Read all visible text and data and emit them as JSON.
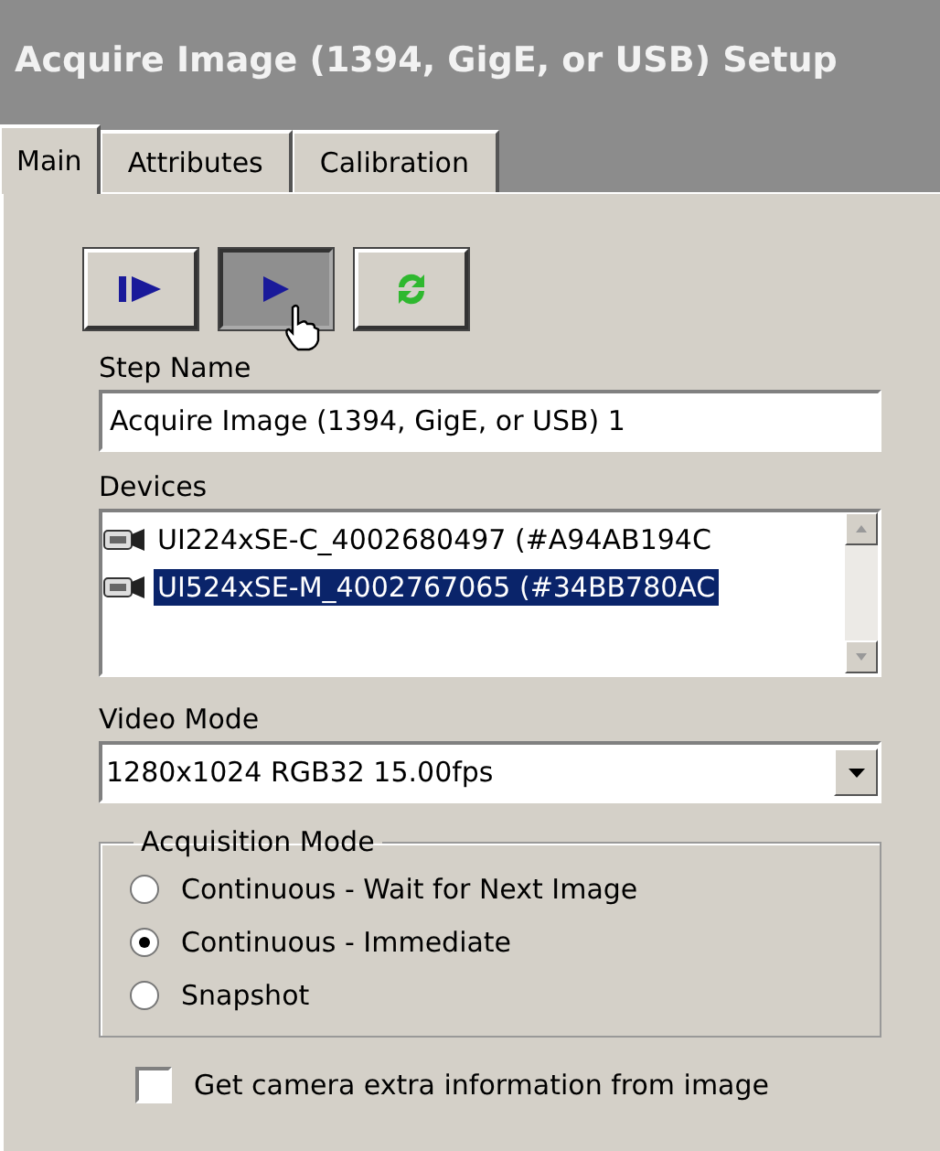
{
  "window": {
    "title": "Acquire Image (1394, GigE, or USB) Setup"
  },
  "tabs": [
    {
      "label": "Main",
      "selected": true
    },
    {
      "label": "Attributes",
      "selected": false
    },
    {
      "label": "Calibration",
      "selected": false
    }
  ],
  "toolbar": [
    {
      "kind": "step",
      "pressed": false
    },
    {
      "kind": "run",
      "pressed": true
    },
    {
      "kind": "refresh",
      "pressed": false
    }
  ],
  "step_name": {
    "label": "Step Name",
    "value": "Acquire Image (1394, GigE, or USB) 1"
  },
  "devices": {
    "label": "Devices",
    "items": [
      {
        "name": "UI224xSE-C_4002680497  (#A94AB194C",
        "selected": false
      },
      {
        "name": "UI524xSE-M_4002767065  (#34BB780AC",
        "selected": true
      }
    ]
  },
  "video_mode": {
    "label": "Video Mode",
    "value": "1280x1024 RGB32 15.00fps"
  },
  "acquisition_mode": {
    "label": "Acquisition Mode",
    "options": [
      {
        "label": "Continuous - Wait for Next Image",
        "selected": false
      },
      {
        "label": "Continuous - Immediate",
        "selected": true
      },
      {
        "label": "Snapshot",
        "selected": false
      }
    ]
  },
  "extra_info": {
    "label": "Get camera extra information from image",
    "checked": false
  }
}
